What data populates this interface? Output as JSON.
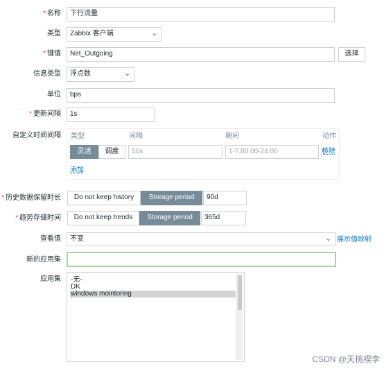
{
  "form": {
    "name": {
      "label": "名称",
      "value": "下行流量",
      "required": true
    },
    "type": {
      "label": "类型",
      "value": "Zabbix 客户端"
    },
    "key": {
      "label": "键值",
      "value": "Net_Outgoing",
      "required": true,
      "select_button": "选择"
    },
    "info_type": {
      "label": "信息类型",
      "value": "浮点数"
    },
    "units": {
      "label": "单位",
      "value": "bps"
    },
    "update_interval": {
      "label": "更新间隔",
      "value": "1s",
      "required": true
    },
    "custom_intervals": {
      "label": "自定义时间间隔",
      "headers": {
        "type": "类型",
        "interval": "间隔",
        "period": "期间",
        "action": "动作"
      },
      "type_flexible": "灵活",
      "type_scheduling": "调度",
      "interval_placeholder": "50s",
      "period_placeholder": "1-7,00:00-24:00",
      "remove": "移除",
      "add": "添加"
    },
    "history": {
      "label": "历史数据保留时长",
      "option_no": "Do not keep history",
      "option_storage": "Storage period",
      "value": "90d",
      "required": true
    },
    "trends": {
      "label": "趋势存储时间",
      "option_no": "Do not keep trends",
      "option_storage": "Storage period",
      "value": "365d",
      "required": true
    },
    "valuemap": {
      "label": "查看值",
      "value": "不变",
      "link": "展示值映射"
    },
    "new_application": {
      "label": "新的应用集",
      "value": ""
    },
    "applications": {
      "label": "应用集",
      "options": [
        "-无-",
        "DK",
        "windows mointoring"
      ],
      "selected_index": 2
    }
  },
  "watermark": "CSDN @天桃褉李",
  "colors": {
    "accent": "#768d99",
    "required": "#e33734",
    "link": "#0275b8",
    "focus_border": "#a8d3a0"
  }
}
